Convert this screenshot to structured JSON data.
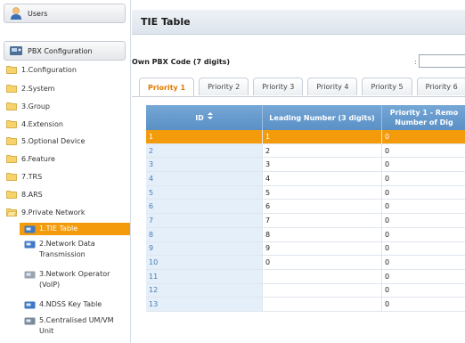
{
  "sidebar": {
    "users_label": "Users",
    "pbx_config_label": "PBX Configuration",
    "items": [
      {
        "label": "1.Configuration"
      },
      {
        "label": "2.System"
      },
      {
        "label": "3.Group"
      },
      {
        "label": "4.Extension"
      },
      {
        "label": "5.Optional Device"
      },
      {
        "label": "6.Feature"
      },
      {
        "label": "7.TRS"
      },
      {
        "label": "8.ARS"
      },
      {
        "label": "9.Private Network"
      }
    ],
    "sub_items": [
      {
        "label": "1.TIE Table",
        "active": true
      },
      {
        "label": "2.Network Data Transmission"
      },
      {
        "label": "3.Network Operator (VoIP)"
      },
      {
        "label": "4.NDSS Key Table"
      },
      {
        "label": "5.Centralised UM/VM Unit"
      }
    ]
  },
  "header": {
    "title": "TIE Table"
  },
  "own_pbx": {
    "label": "Own PBX Code (7 digits)",
    "colon": ":",
    "value": ""
  },
  "tabs": [
    {
      "label": "Priority 1",
      "active": true
    },
    {
      "label": "Priority 2"
    },
    {
      "label": "Priority 3"
    },
    {
      "label": "Priority 4"
    },
    {
      "label": "Priority 5"
    },
    {
      "label": "Priority 6"
    }
  ],
  "table": {
    "headers": {
      "id": "ID",
      "sort_icon": "sort-icon",
      "leading": "Leading Number (3 digits)",
      "p1_line1": "Priority 1 - Remo",
      "p1_line2": "Number of Dig"
    },
    "rows": [
      {
        "id": "1",
        "leading": "1",
        "p1": "0",
        "selected": true
      },
      {
        "id": "2",
        "leading": "2",
        "p1": "0"
      },
      {
        "id": "3",
        "leading": "3",
        "p1": "0"
      },
      {
        "id": "4",
        "leading": "4",
        "p1": "0"
      },
      {
        "id": "5",
        "leading": "5",
        "p1": "0"
      },
      {
        "id": "6",
        "leading": "6",
        "p1": "0"
      },
      {
        "id": "7",
        "leading": "7",
        "p1": "0"
      },
      {
        "id": "8",
        "leading": "8",
        "p1": "0"
      },
      {
        "id": "9",
        "leading": "9",
        "p1": "0"
      },
      {
        "id": "10",
        "leading": "0",
        "p1": "0"
      },
      {
        "id": "11",
        "leading": "",
        "p1": "0"
      },
      {
        "id": "12",
        "leading": "",
        "p1": "0"
      },
      {
        "id": "13",
        "leading": "",
        "p1": "0"
      }
    ]
  },
  "colors": {
    "accent_orange": "#f49b0c",
    "header_blue": "#5a90c6",
    "id_cell_blue": "#e5effa"
  }
}
